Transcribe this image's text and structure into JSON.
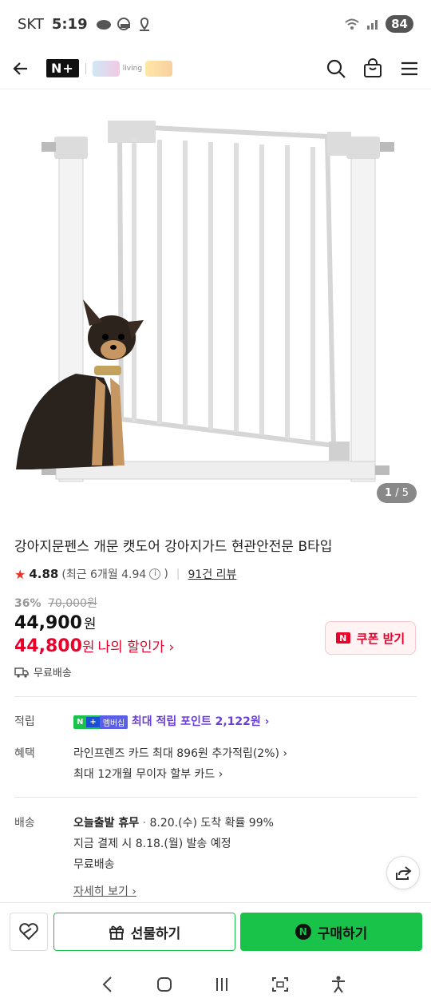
{
  "status": {
    "carrier": "SKT",
    "time": "5:19",
    "battery": "84"
  },
  "header": {
    "brand": "N+",
    "living_text": "living"
  },
  "image": {
    "pager_current": "1",
    "pager_total": "/ 5"
  },
  "product": {
    "title": "강아지문펜스 개문 캣도어 강아지가드 현관안전문 B타입",
    "rating": "4.88",
    "recent_rating": "(최근 6개월 4.94",
    "recent_close": ")",
    "reviews": "91건 리뷰",
    "discount_pct": "36%",
    "original_price": "70,000원",
    "price": "44,900",
    "price_unit": "원",
    "my_price": "44,800",
    "my_price_unit": "원",
    "my_price_label": "나의 할인가 ›",
    "coupon_label": "쿠폰 받기",
    "shipping_short": "무료배송"
  },
  "rows": {
    "points_label": "적립",
    "points_badge_n": "N",
    "points_badge_plus": "+",
    "points_badge_member": "멤버십",
    "points_text": "최대 적립 포인트 2,122원 ›",
    "benefit_label": "혜택",
    "benefit_line1": "라인프렌즈 카드 최대 896원 추가적립(2%) ›",
    "benefit_line2": "최대 12개월 무이자 할부 카드 ›",
    "delivery_label": "배송",
    "delivery_bold": "오늘출발 휴무",
    "delivery_dot": "·",
    "delivery_line1": "8.20.(수) 도착 확률 99%",
    "delivery_line2": "지금 결제 시 8.18.(월) 발송 예정",
    "delivery_line3": "무료배송",
    "details_link": "자세히 보기 ›"
  },
  "bottom": {
    "gift_label": "선물하기",
    "buy_label": "구매하기",
    "buy_badge": "N"
  },
  "colors": {
    "naver_green": "#19c34a",
    "sale_red": "#e8002a",
    "purple": "#6a3fd6"
  }
}
